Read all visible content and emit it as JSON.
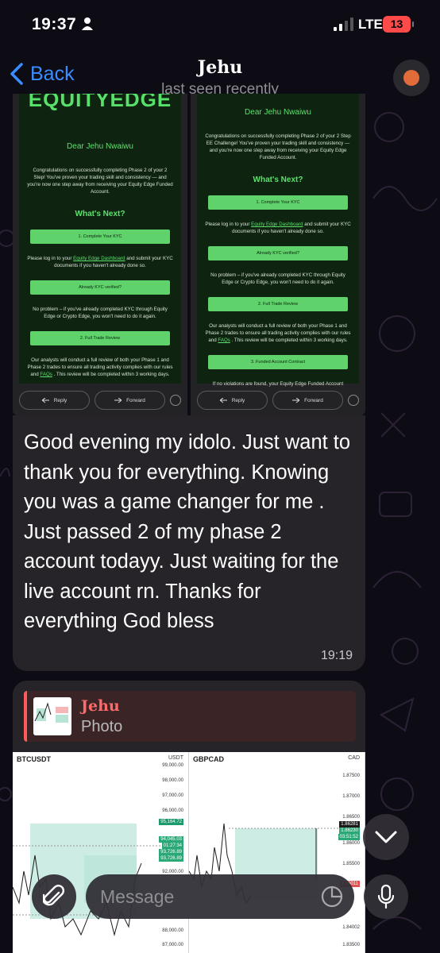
{
  "status": {
    "time": "19:37",
    "network": "LTE",
    "battery": "13"
  },
  "header": {
    "back_label": "Back",
    "title": "Jehu",
    "subtitle": "last seen recently"
  },
  "emails": {
    "left": {
      "brand": "EQUITYEDGE",
      "greeting": "Dear Jehu Nwaiwu",
      "intro": "Congratulations on successfully completing Phase 2 of your 2 Step! You've proven your trading skill and consistency — and you're now one step away from receiving your Equity Edge Funded Account.",
      "next_heading": "What's Next?",
      "step1": "1. Complete Your KYC",
      "kyc_text_a": "Please log in to your ",
      "kyc_link": "Equity Edge Dashboard",
      "kyc_text_b": " and submit your KYC documents if you haven't already done so.",
      "verified_btn": "Already KYC verified?",
      "noproblem": "No problem – if you've already completed KYC through Equity Edge or Crypto Edge, you won't need to do it again.",
      "step2": "2. Full Trade Review",
      "review_a": "Our analysts will conduct a full review of both your Phase 1 and Phase 2 trades to ensure all trading activity complies with our rules and ",
      "review_link": "FAQs",
      "review_b": " . This review will be completed within 3 working days.",
      "reply": "Reply",
      "forward": "Forward"
    },
    "right": {
      "greeting": "Dear Jehu Nwaiwu",
      "intro": "Congratulations on successfully completing Phase 2 of your 2 Step EE Challenge! You've proven your trading skill and consistency — and you're now one step away from receiving your Equity Edge Funded Account.",
      "next_heading": "What's Next?",
      "step1": "1. Complete Your KYC",
      "kyc_text_a": "Please log in to your ",
      "kyc_link": "Equity Edge Dashboard",
      "kyc_text_b": " and submit your KYC documents if you haven't already done so.",
      "verified_btn": "Already KYC verified?",
      "noproblem": "No problem – if you've already completed KYC through Equity Edge or Crypto Edge, you won't need to do it again.",
      "step2": "2. Full Trade Review",
      "review_a": "Our analysts will conduct a full review of both your Phase 1 and Phase 2 trades to ensure all trading activity complies with our rules and ",
      "review_link": "FAQs",
      "review_b": " . This review will be completed within 3 working days.",
      "step3": "3. Funded Account Contract",
      "contract": "If no violations are found, your Equity Edge Funded Account",
      "reply": "Reply",
      "forward": "Forward"
    }
  },
  "message": {
    "text": "Good evening my idolo. Just want to thank you for everything.  Knowing you was a game changer for me . Just passed 2 of my phase 2 account todayy. Just waiting for the live account rn. Thanks for everything God bless",
    "time": "19:19"
  },
  "photo_message": {
    "reply_name": "Jehu",
    "reply_type": "Photo",
    "left_chart": {
      "symbol": "BTCUSDT",
      "currency": "USDT",
      "ticks": [
        "99,000.00",
        "98,000.00",
        "97,000.00",
        "96,000.00",
        "95,164.72",
        "94,045.03",
        "01:27:34",
        "93,726.89",
        "93,726.89",
        "92,000.00",
        "88,000.00",
        "87,000.00"
      ]
    },
    "right_chart": {
      "symbol": "GBPCAD",
      "currency": "CAD",
      "ticks": [
        "1.87500",
        "1.87000",
        "1.86500",
        "1.86281",
        "1.86230",
        "03:51:52",
        "1.86000",
        "1.85500",
        "1.85011",
        "1.84002",
        "1.83500"
      ]
    }
  },
  "composer": {
    "placeholder": "Message"
  },
  "colors": {
    "accent": "#3a8dff",
    "bubble": "#262429",
    "email_green": "#5fd26b",
    "reply_bar": "#ff5a5a"
  },
  "icons": [
    "person-icon",
    "chevron-left-icon",
    "reply-icon",
    "forward-icon",
    "emoji-icon",
    "chevron-down-icon",
    "paperclip-icon",
    "sticker-icon",
    "microphone-icon"
  ]
}
